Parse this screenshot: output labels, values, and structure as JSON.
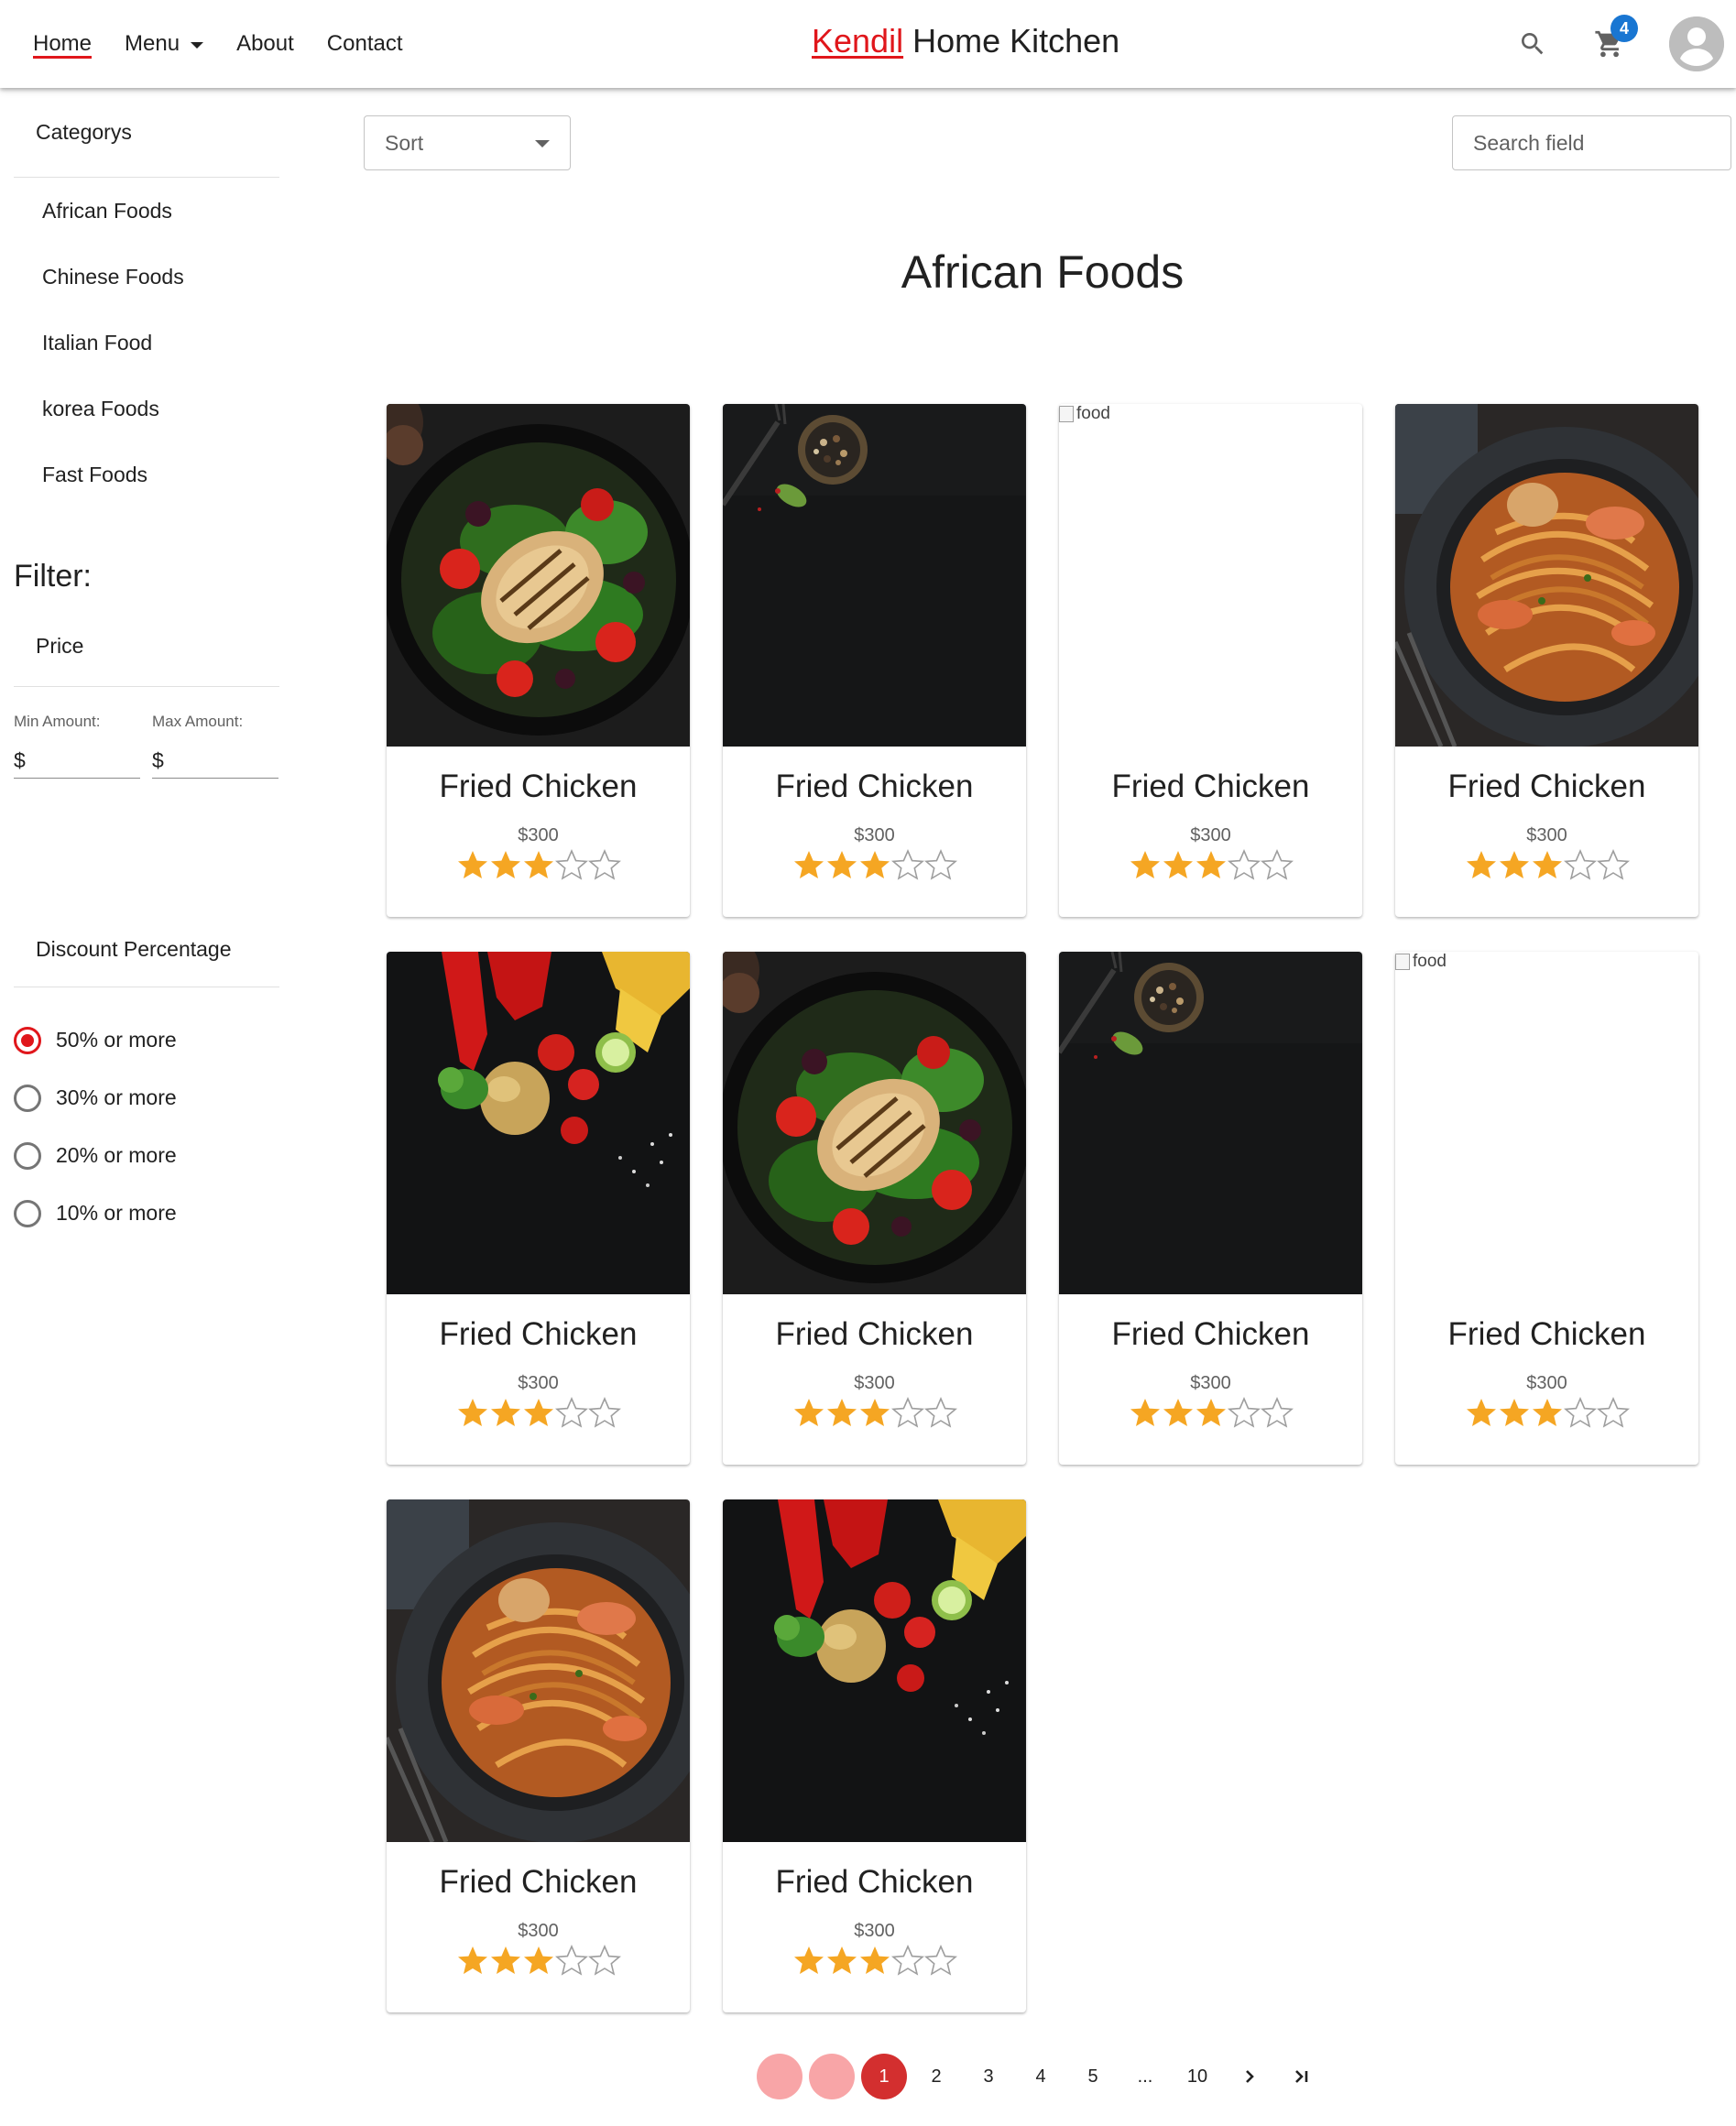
{
  "header": {
    "nav": [
      {
        "label": "Home",
        "active": true
      },
      {
        "label": "Menu",
        "dropdown": true
      },
      {
        "label": "About"
      },
      {
        "label": "Contact"
      }
    ],
    "brand_accent": "Kendil",
    "brand_rest": " Home Kitchen",
    "cart_count": "4",
    "icons": [
      "search-icon",
      "cart-icon",
      "account-icon"
    ],
    "colors": {
      "accent": "#e0161b",
      "badge": "#1976d2"
    }
  },
  "sidebar": {
    "categories_title": "Categorys",
    "categories": [
      "African Foods",
      "Chinese Foods",
      "Italian Food",
      "korea Foods",
      "Fast Foods"
    ],
    "filter_title": "Filter:",
    "price_title": "Price",
    "min_label": "Min Amount:",
    "max_label": "Max Amount:",
    "min_value": "$",
    "max_value": "$",
    "discount_title": "Discount Percentage",
    "discounts": [
      {
        "label": "50% or more",
        "checked": true
      },
      {
        "label": "30% or more",
        "checked": false
      },
      {
        "label": "20% or more",
        "checked": false
      },
      {
        "label": "10% or more",
        "checked": false
      }
    ]
  },
  "toolbar": {
    "sort_label": "Sort",
    "search_placeholder": "Search field"
  },
  "page_title": "African Foods",
  "products": [
    {
      "name": "Fried Chicken",
      "price": "$300",
      "rating": 3,
      "image": "salad"
    },
    {
      "name": "Fried Chicken",
      "price": "$300",
      "rating": 3,
      "image": "spices"
    },
    {
      "name": "Fried Chicken",
      "price": "$300",
      "rating": 3,
      "image": "broken",
      "alt": "food"
    },
    {
      "name": "Fried Chicken",
      "price": "$300",
      "rating": 3,
      "image": "pasta"
    },
    {
      "name": "Fried Chicken",
      "price": "$300",
      "rating": 3,
      "image": "veggies"
    },
    {
      "name": "Fried Chicken",
      "price": "$300",
      "rating": 3,
      "image": "salad"
    },
    {
      "name": "Fried Chicken",
      "price": "$300",
      "rating": 3,
      "image": "spices"
    },
    {
      "name": "Fried Chicken",
      "price": "$300",
      "rating": 3,
      "image": "broken",
      "alt": "food"
    },
    {
      "name": "Fried Chicken",
      "price": "$300",
      "rating": 3,
      "image": "pasta"
    },
    {
      "name": "Fried Chicken",
      "price": "$300",
      "rating": 3,
      "image": "veggies"
    }
  ],
  "pagination": {
    "pages": [
      "1",
      "2",
      "3",
      "4",
      "5",
      "...",
      "10"
    ],
    "current": "1"
  }
}
